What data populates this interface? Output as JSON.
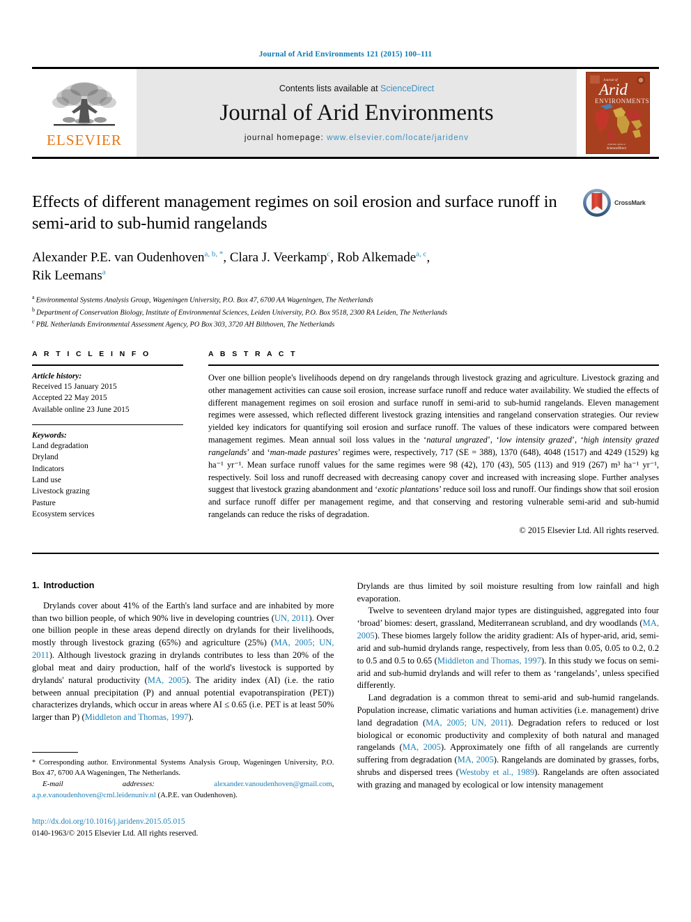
{
  "running_head": "Journal of Arid Environments 121 (2015) 100–111",
  "masthead": {
    "publisher_name": "ELSEVIER",
    "contents_prefix": "Contents lists available at ",
    "contents_link": "ScienceDirect",
    "journal_name": "Journal of Arid Environments",
    "homepage_prefix": "journal homepage: ",
    "homepage_url": "www.elsevier.com/locate/jaridenv",
    "cover": {
      "line1": "Journal of",
      "line2": "Arid",
      "line3": "ENVIRONMENTS",
      "footer": "Available online at",
      "footer2": "ScienceDirect",
      "bg_color": "#a8401f"
    }
  },
  "article": {
    "title": "Effects of different management regimes on soil erosion and surface runoff in semi-arid to sub-humid rangelands",
    "crossmark_label": "CrossMark",
    "authors_line1_a": "Alexander P.E. van Oudenhoven",
    "authors_line1_a_sup": "a, b, *",
    "authors_line1_b": ", Clara J. Veerkamp",
    "authors_line1_b_sup": "c",
    "authors_line1_c": ", Rob Alkemade",
    "authors_line1_c_sup": "a, c",
    "authors_line1_tail": ",",
    "authors_line2": "Rik Leemans",
    "authors_line2_sup": "a",
    "affiliations": [
      {
        "marker": "a",
        "text": "Environmental Systems Analysis Group, Wageningen University, P.O. Box 47, 6700 AA Wageningen, The Netherlands"
      },
      {
        "marker": "b",
        "text": "Department of Conservation Biology, Institute of Environmental Sciences, Leiden University, P.O. Box 9518, 2300 RA Leiden, The Netherlands"
      },
      {
        "marker": "c",
        "text": "PBL Netherlands Environmental Assessment Agency, PO Box 303, 3720 AH Bilthoven, The Netherlands"
      }
    ]
  },
  "article_info": {
    "heading": "A R T I C L E   I N F O",
    "history_label": "Article history:",
    "history": [
      "Received 15 January 2015",
      "Accepted 22 May 2015",
      "Available online 23 June 2015"
    ],
    "keywords_label": "Keywords:",
    "keywords": [
      "Land degradation",
      "Dryland",
      "Indicators",
      "Land use",
      "Livestock grazing",
      "Pasture",
      "Ecosystem services"
    ]
  },
  "abstract": {
    "heading": "A B S T R A C T",
    "paragraph_parts": [
      {
        "t": "Over one billion people's livelihoods depend on dry rangelands through livestock grazing and agriculture. Livestock grazing and other management activities can cause soil erosion, increase surface runoff and reduce water availability. We studied the effects of different management regimes on soil erosion and surface runoff in semi-arid to sub-humid rangelands. Eleven management regimes were assessed, which reflected different livestock grazing intensities and rangeland conservation strategies. Our review yielded key indicators for quantifying soil erosion and surface runoff. The values of these indicators were compared between management regimes. Mean annual soil loss values in the ‘"
      },
      {
        "i": "natural ungrazed"
      },
      {
        "t": "’, ‘"
      },
      {
        "i": "low intensity grazed"
      },
      {
        "t": "’, ‘"
      },
      {
        "i": "high intensity grazed rangelands"
      },
      {
        "t": "’ and ‘"
      },
      {
        "i": "man-made pastures"
      },
      {
        "t": "’ regimes were, respectively, 717 (SE = 388), 1370 (648), 4048 (1517) and 4249 (1529) kg ha⁻¹ yr⁻¹. Mean surface runoff values for the same regimes were 98 (42), 170 (43), 505 (113) and 919 (267) m³ ha⁻¹ yr⁻¹, respectively. Soil loss and runoff decreased with decreasing canopy cover and increased with increasing slope. Further analyses suggest that livestock grazing abandonment and ‘"
      },
      {
        "i": "exotic plantations"
      },
      {
        "t": "’ reduce soil loss and runoff. Our findings show that soil erosion and surface runoff differ per management regime, and that conserving and restoring vulnerable semi-arid and sub-humid rangelands can reduce the risks of degradation."
      }
    ],
    "copyright": "© 2015 Elsevier Ltd. All rights reserved."
  },
  "body": {
    "section_number": "1.",
    "section_title": "Introduction",
    "left_paragraphs": [
      [
        {
          "t": "Drylands cover about 41% of the Earth's land surface and are inhabited by more than two billion people, of which 90% live in developing countries ("
        },
        {
          "c": "UN, 2011"
        },
        {
          "t": "). Over one billion people in these areas depend directly on drylands for their livelihoods, mostly through livestock grazing (65%) and agriculture (25%) ("
        },
        {
          "c": "MA, 2005; UN, 2011"
        },
        {
          "t": "). Although livestock grazing in drylands contributes to less than 20% of the global meat and dairy production, half of the world's livestock is supported by drylands' natural productivity ("
        },
        {
          "c": "MA, 2005"
        },
        {
          "t": "). The aridity index (AI) (i.e. the ratio between annual precipitation (P) and annual potential evapotranspiration (PET)) characterizes drylands, which occur in areas where AI ≤ 0.65 (i.e. PET is at least 50% larger than P) ("
        },
        {
          "c": "Middleton and Thomas, 1997"
        },
        {
          "t": ")."
        }
      ]
    ],
    "right_paragraphs": [
      [
        {
          "t": "Drylands are thus limited by soil moisture resulting from low rainfall and high evaporation."
        }
      ],
      [
        {
          "t": "Twelve to seventeen dryland major types are distinguished, aggregated into four ‘broad’ biomes: desert, grassland, Mediterranean scrubland, and dry woodlands ("
        },
        {
          "c": "MA, 2005"
        },
        {
          "t": "). These biomes largely follow the aridity gradient: AIs of hyper-arid, arid, semi-arid and sub-humid drylands range, respectively, from less than 0.05, 0.05 to 0.2, 0.2 to 0.5 and 0.5 to 0.65 ("
        },
        {
          "c": "Middleton and Thomas, 1997"
        },
        {
          "t": "). In this study we focus on semi-arid and sub-humid drylands and will refer to them as ‘rangelands’, unless specified differently."
        }
      ],
      [
        {
          "t": "Land degradation is a common threat to semi-arid and sub-humid rangelands. Population increase, climatic variations and human activities (i.e. management) drive land degradation ("
        },
        {
          "c": "MA, 2005; UN, 2011"
        },
        {
          "t": "). Degradation refers to reduced or lost biological or economic productivity and complexity of both natural and managed rangelands ("
        },
        {
          "c": "MA, 2005"
        },
        {
          "t": "). Approximately one fifth of all rangelands are currently suffering from degradation ("
        },
        {
          "c": "MA, 2005"
        },
        {
          "t": "). Rangelands are dominated by grasses, forbs, shrubs and dispersed trees ("
        },
        {
          "c": "Westoby et al., 1989"
        },
        {
          "t": "). Rangelands are often associated with grazing and managed by ecological or low intensity management"
        }
      ]
    ]
  },
  "footnote": {
    "star": "*",
    "corresponding": " Corresponding author. Environmental Systems Analysis Group, Wageningen University, P.O. Box 47, 6700 AA Wageningen, The Netherlands.",
    "email_label": "E-mail addresses:",
    "email1": "alexander.vanoudenhoven@gmail.com",
    "email_sep": ", ",
    "email2": "a.p.e.vanoudenhoven@cml.leidenuniv.nl",
    "email_tail": " (A.P.E. van Oudenhoven)."
  },
  "footer": {
    "doi": "http://dx.doi.org/10.1016/j.jaridenv.2015.05.015",
    "issn_line": "0140-1963/© 2015 Elsevier Ltd. All rights reserved."
  },
  "colors": {
    "link_blue": "#1a7fb5",
    "accent_orange": "#e87511",
    "masthead_gray": "#e7e7e7"
  }
}
